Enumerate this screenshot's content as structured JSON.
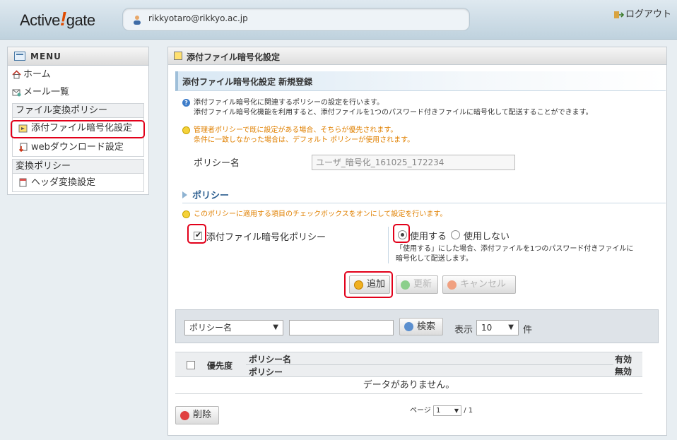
{
  "header": {
    "logo_prefix": "Active",
    "logo_bang": "!",
    "logo_suffix": "gate",
    "user_email": "rikkyotaro@rikkyo.ac.jp",
    "logout_label": "ログアウト"
  },
  "sidebar": {
    "menu_title": "MENU",
    "items": [
      {
        "label": "ホーム",
        "icon": "home-icon"
      },
      {
        "label": "メール一覧",
        "icon": "mail-list-icon"
      }
    ],
    "groups": [
      {
        "title": "ファイル変換ポリシー",
        "items": [
          {
            "label": "添付ファイル暗号化設定",
            "icon": "lock-folder-icon",
            "active": true
          },
          {
            "label": "webダウンロード設定",
            "icon": "download-icon"
          }
        ]
      },
      {
        "title": "変換ポリシー",
        "items": [
          {
            "label": "ヘッダ変換設定",
            "icon": "header-icon"
          }
        ]
      }
    ]
  },
  "main": {
    "title": "添付ファイル暗号化設定",
    "subtitle": "添付ファイル暗号化設定 新規登録",
    "info_line1": "添付ファイル暗号化に関連するポリシーの設定を行います。",
    "info_line2": "添付ファイル暗号化機能を利用すると、添付ファイルを1つのパスワード付きファイルに暗号化して配送することができます。",
    "warn_line1": "管理者ポリシーで既に設定がある場合、そちらが優先されます。",
    "warn_line2": "条件に一致しなかった場合は、デフォルト ポリシーが使用されます。",
    "policy_name_label": "ポリシー名",
    "policy_name_value": "ユーザ_暗号化_161025_172234",
    "policy_section": "ポリシー",
    "policy_hint": "このポリシーに適用する項目のチェックボックスをオンにして設定を行います。",
    "encrypt_policy_label": "添付ファイル暗号化ポリシー",
    "use_label": "使用する",
    "nouse_label": "使用しない",
    "use_desc1": "「使用する」にした場合、添付ファイルを1つのパスワード付きファイルに",
    "use_desc2": "暗号化して配送します。",
    "add_label": "追加",
    "update_label": "更新",
    "cancel_label": "キャンセル"
  },
  "search": {
    "field_select": "ポリシー名",
    "search_label": "検索",
    "display_label": "表示",
    "per_page": "10",
    "unit": "件"
  },
  "table": {
    "col_priority": "優先度",
    "col_policy_name": "ポリシー名",
    "col_policy": "ポリシー",
    "col_enabled": "有効",
    "col_disabled": "無効",
    "empty": "データがありません。",
    "delete_label": "削除",
    "page_label": "ページ",
    "page_current": "1",
    "page_total": "/ 1"
  },
  "colors": {
    "highlight": "#e2001a",
    "accent": "#2a5d8f",
    "warning_text": "#e08000"
  }
}
